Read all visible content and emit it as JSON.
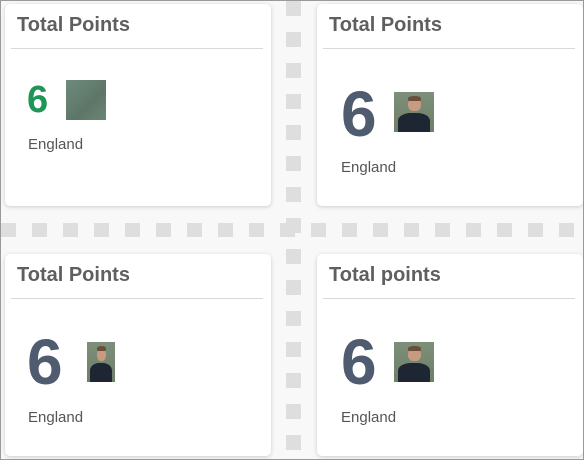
{
  "cards": [
    {
      "title": "Total Points",
      "points": "6",
      "country": "England"
    },
    {
      "title": "Total Points",
      "points": "6",
      "country": "England"
    },
    {
      "title": "Total Points",
      "points": "6",
      "country": "England"
    },
    {
      "title": "Total points",
      "points": "6",
      "country": "England"
    }
  ],
  "colors": {
    "points_green": "#1f9657",
    "points_slate": "#4f5b6e"
  },
  "icons": [
    "player-photo-placeholder",
    "player-photo"
  ]
}
